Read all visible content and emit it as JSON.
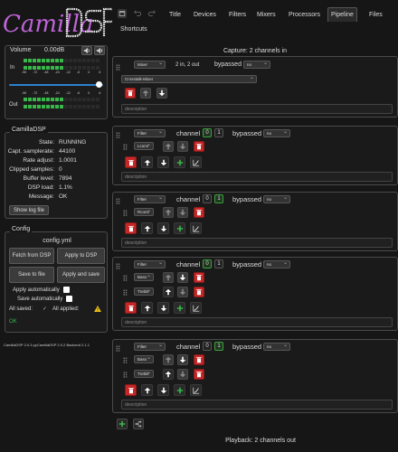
{
  "app": {
    "logo_text": "CamillaDSP"
  },
  "volume": {
    "label": "Volume",
    "value": "0.00dB",
    "in_label": "In",
    "out_label": "Out",
    "scale": [
      "-96",
      "-72",
      "-48",
      "-24",
      "-12",
      "-6",
      "0",
      "6"
    ],
    "in_level": 0.5,
    "out_level": 0.5,
    "slider": 0.97
  },
  "status": {
    "title": "CamillaDSP",
    "rows": [
      {
        "k": "State:",
        "v": "RUNNING"
      },
      {
        "k": "Capt. samplerate:",
        "v": "44100"
      },
      {
        "k": "Rate adjust:",
        "v": "1.0001"
      },
      {
        "k": "Clipped samples:",
        "v": "0"
      },
      {
        "k": "Buffer level:",
        "v": "7894"
      },
      {
        "k": "DSP load:",
        "v": "1.1%"
      },
      {
        "k": "Message:",
        "v": "OK"
      }
    ],
    "show_log": "Show log file"
  },
  "config": {
    "title": "Config",
    "file": "config.yml",
    "fetch": "Fetch from DSP",
    "apply": "Apply to DSP",
    "save": "Save to file",
    "apply_save": "Apply and save",
    "apply_auto": "Apply automatically",
    "save_auto": "Save automatically",
    "all_saved": "All saved:",
    "all_applied": "All applied:",
    "ok": "OK"
  },
  "versions": {
    "text": "CamillaDSP 2.0.3   pyCamillaDSP 2.0.2   Backend 2.1.1"
  },
  "tabs": [
    "Title",
    "Devices",
    "Filters",
    "Mixers",
    "Processors",
    "Pipeline",
    "Files",
    "Shortcuts"
  ],
  "active_tab": "Pipeline",
  "pipeline": {
    "capture": "Capture: 2 channels in",
    "playback": "Playback: 2 channels out",
    "mixer": {
      "type": "Mixer",
      "io": "2 in, 2 out",
      "bypassed": "bypassed",
      "bypass_value": "no",
      "name": "Crosstalk-Mixer",
      "description": "description"
    },
    "filters": [
      {
        "type": "Filter",
        "channel_label": "channel",
        "channels": [
          "0",
          "1"
        ],
        "active": [
          true,
          false
        ],
        "bypassed": "bypassed",
        "bypass_value": "no",
        "names": [
          "Lconv"
        ],
        "description": "description"
      },
      {
        "type": "Filter",
        "channel_label": "channel",
        "channels": [
          "0",
          "1"
        ],
        "active": [
          false,
          true
        ],
        "bypassed": "bypassed",
        "bypass_value": "no",
        "names": [
          "Rconv"
        ],
        "description": "description"
      },
      {
        "type": "Filter",
        "channel_label": "channel",
        "channels": [
          "0",
          "1"
        ],
        "active": [
          true,
          false
        ],
        "bypassed": "bypassed",
        "bypass_value": "no",
        "names": [
          "Bass",
          "Treble"
        ],
        "description": "description"
      },
      {
        "type": "Filter",
        "channel_label": "channel",
        "channels": [
          "0",
          "1"
        ],
        "active": [
          false,
          true
        ],
        "bypassed": "bypassed",
        "bypass_value": "no",
        "names": [
          "Bass",
          "Treble"
        ],
        "description": "description"
      }
    ]
  },
  "colors": {
    "accent_green": "#38b84a",
    "danger_red": "#c62828",
    "warning": "#f0c419"
  }
}
